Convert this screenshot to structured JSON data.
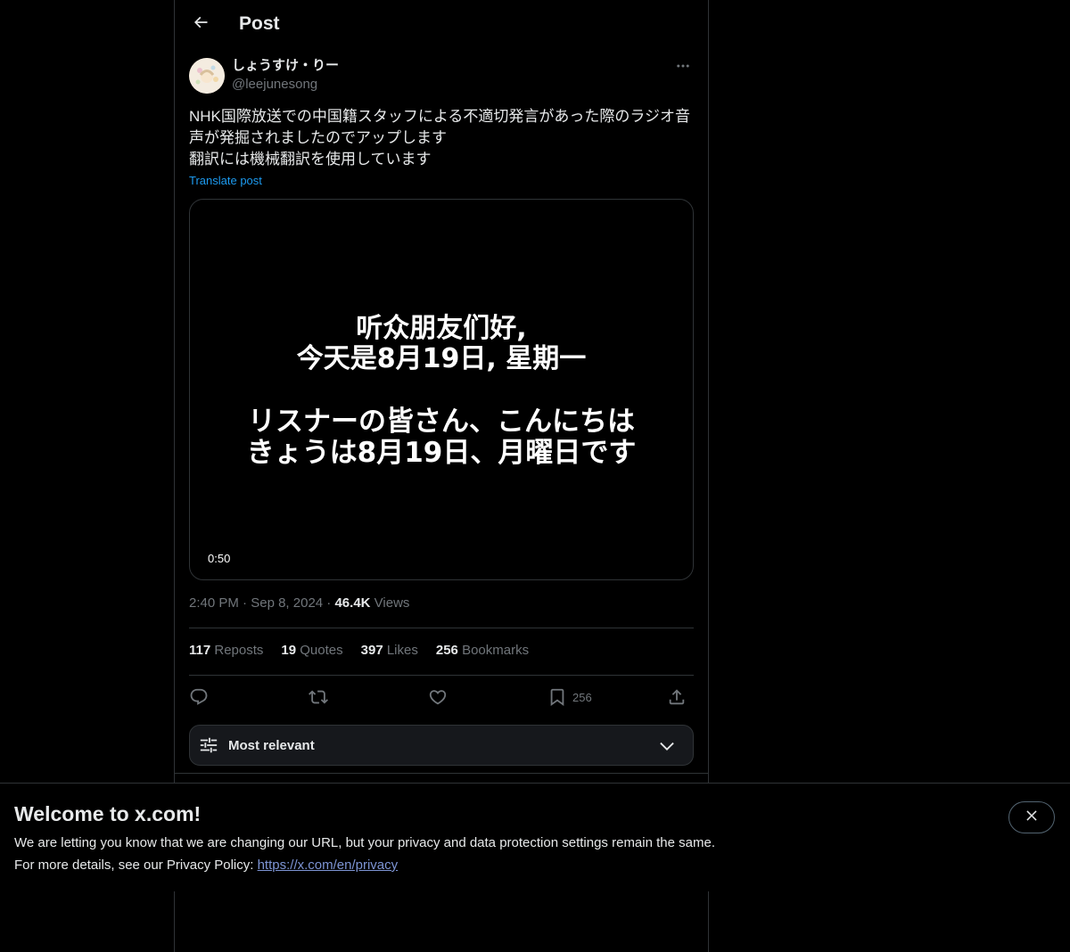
{
  "header": {
    "title": "Post",
    "back_icon": "arrow-left-icon"
  },
  "post": {
    "author": {
      "display_name": "しょうすけ・りー",
      "handle": "@leejunesong"
    },
    "more_icon": "ellipsis-icon",
    "text": "NHK国際放送での中国籍スタッフによる不適切発言があった際のラジオ音声が発掘されましたのでアップします\n翻訳には機械翻訳を使用しています",
    "translate_label": "Translate post",
    "media": {
      "caption_lines": [
        "听众朋友们好,",
        "今天是8月19日, 星期一",
        "リスナーの皆さん、こんにちは",
        "きょうは8月19日、月曜日です"
      ],
      "duration": "0:50"
    },
    "meta": {
      "time": "2:40 PM",
      "separator": "·",
      "date": "Sep 8, 2024",
      "views_count": "46.4K",
      "views_label": "Views"
    },
    "stats": [
      {
        "count": "117",
        "label": "Reposts"
      },
      {
        "count": "19",
        "label": "Quotes"
      },
      {
        "count": "397",
        "label": "Likes"
      },
      {
        "count": "256",
        "label": "Bookmarks"
      }
    ],
    "actions": {
      "reply_icon": "reply-icon",
      "repost_icon": "repost-icon",
      "like_icon": "heart-icon",
      "bookmark_icon": "bookmark-icon",
      "bookmark_count": "256",
      "share_icon": "share-icon"
    }
  },
  "sort": {
    "label": "Most relevant",
    "icon": "sliders-icon",
    "chevron_icon": "chevron-down-icon"
  },
  "banner": {
    "title": "Welcome to x.com!",
    "line1": "We are letting you know that we are changing our URL, but your privacy and data protection settings remain the same.",
    "line2_prefix": "For more details, see our Privacy Policy: ",
    "link_text": "https://x.com/en/privacy",
    "close_icon": "close-icon"
  },
  "colors": {
    "background": "#000000",
    "text": "#e7e9ea",
    "secondary": "#71767b",
    "accent": "#1d9bf0",
    "border": "#2f3336"
  }
}
